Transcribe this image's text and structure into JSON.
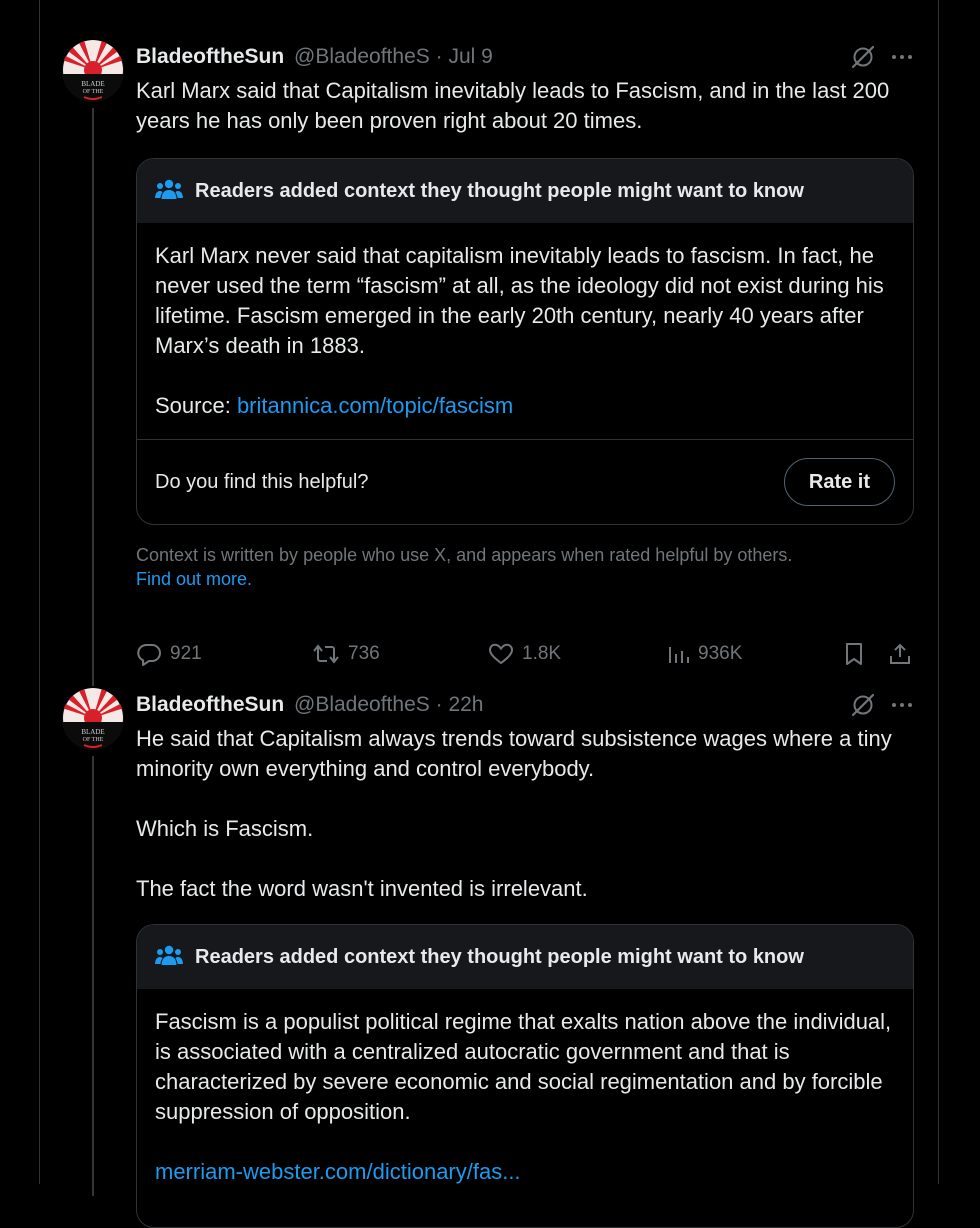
{
  "tweets": [
    {
      "name": "BladeoftheSun",
      "handle": "@BladeoftheS",
      "time": "Jul 9",
      "text": "Karl Marx said that Capitalism inevitably leads to Fascism, and in the last 200 years he has only been proven right about 20 times.",
      "note": {
        "header": "Readers added context they thought people might want to know",
        "body": "Karl Marx never said that capitalism inevitably leads to fascism. In fact, he never used the term “fascism” at all, as the ideology did not exist during his lifetime. Fascism emerged in the early 20th century, nearly 40 years after Marx’s death in 1883.",
        "source_label": "Source: ",
        "source_link": "britannica.com/topic/fascism",
        "helpful_question": "Do you find this helpful?",
        "rate_label": "Rate it"
      },
      "context_text": "Context is written by people who use X, and appears when rated helpful by others.",
      "find_out_more": "Find out more.",
      "metrics": {
        "replies": "921",
        "reposts": "736",
        "likes": "1.8K",
        "views": "936K"
      }
    },
    {
      "name": "BladeoftheSun",
      "handle": "@BladeoftheS",
      "time": "22h",
      "text": "He said that Capitalism always trends toward subsistence wages where a tiny minority own everything and control everybody.\n\nWhich is Fascism.\n\nThe fact the word wasn't invented is irrelevant.",
      "note": {
        "header": "Readers added context they thought people might want to know",
        "body": "Fascism is a populist political regime that exalts nation above the individual,  is associated with a centralized autocratic government and that is characterized by severe economic and social regimentation and by forcible suppression of opposition.",
        "source_link": "merriam-webster.com/dictionary/fas..."
      }
    }
  ],
  "separator": " · ",
  "icons": {
    "grok": "grok-slash-icon",
    "more": "more-dots-icon",
    "notes": "community-notes-people-icon",
    "reply": "reply-icon",
    "repost": "repost-icon",
    "like": "like-heart-icon",
    "views": "views-bars-icon",
    "bookmark": "bookmark-icon",
    "share": "share-icon"
  },
  "colors": {
    "accent": "#1d9bf0",
    "muted": "#71767b",
    "avatar_red": "#d8202a"
  }
}
